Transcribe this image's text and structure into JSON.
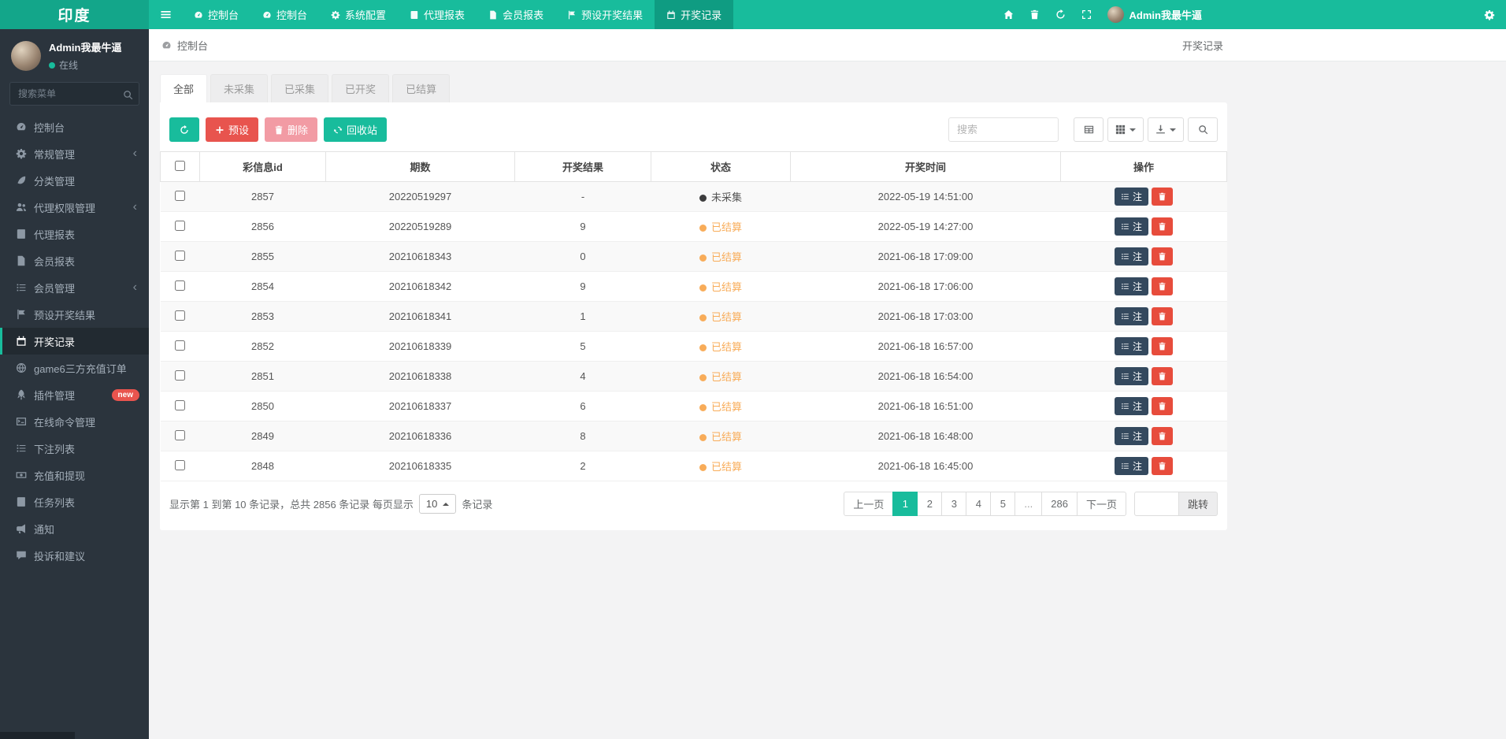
{
  "topbar": {
    "logo": "印度",
    "nav_items": [
      {
        "label": "控制台",
        "icon": "gauge",
        "active": false
      },
      {
        "label": "控制台",
        "icon": "gauge",
        "active": false
      },
      {
        "label": "系统配置",
        "icon": "gear",
        "active": false
      },
      {
        "label": "代理报表",
        "icon": "book",
        "active": false
      },
      {
        "label": "会员报表",
        "icon": "doc",
        "active": false
      },
      {
        "label": "预设开奖结果",
        "icon": "flag",
        "active": false
      },
      {
        "label": "开奖记录",
        "icon": "calendar",
        "active": true
      }
    ],
    "right_icons": [
      "home",
      "trash",
      "refresh",
      "expand"
    ],
    "user_name": "Admin我最牛逼"
  },
  "sidebar": {
    "user_name": "Admin我最牛逼",
    "status_label": "在线",
    "search_placeholder": "搜索菜单",
    "items": [
      {
        "label": "控制台",
        "icon": "gauge"
      },
      {
        "label": "常规管理",
        "icon": "gear",
        "chevron": true
      },
      {
        "label": "分类管理",
        "icon": "leaf"
      },
      {
        "label": "代理权限管理",
        "icon": "users",
        "chevron": true
      },
      {
        "label": "代理报表",
        "icon": "book"
      },
      {
        "label": "会员报表",
        "icon": "doc"
      },
      {
        "label": "会员管理",
        "icon": "list",
        "chevron": true
      },
      {
        "label": "预设开奖结果",
        "icon": "flag"
      },
      {
        "label": "开奖记录",
        "icon": "calendar",
        "active": true
      },
      {
        "label": "game6三方充值订单",
        "icon": "globe"
      },
      {
        "label": "插件管理",
        "icon": "rocket",
        "badge": "new"
      },
      {
        "label": "在线命令管理",
        "icon": "terminal"
      },
      {
        "label": "下注列表",
        "icon": "list"
      },
      {
        "label": "充值和提现",
        "icon": "money"
      },
      {
        "label": "任务列表",
        "icon": "book"
      },
      {
        "label": "通知",
        "icon": "bullhorn"
      },
      {
        "label": "投诉和建议",
        "icon": "comment"
      }
    ]
  },
  "breadcrumb": {
    "left": "控制台",
    "right": "开奖记录"
  },
  "tabs": [
    {
      "label": "全部",
      "active": true
    },
    {
      "label": "未采集",
      "active": false
    },
    {
      "label": "已采集",
      "active": false
    },
    {
      "label": "已开奖",
      "active": false
    },
    {
      "label": "已结算",
      "active": false
    }
  ],
  "toolbar": {
    "preset_label": "预设",
    "delete_label": "删除",
    "recycle_label": "回收站",
    "search_placeholder": "搜索"
  },
  "table": {
    "columns": [
      "彩信息id",
      "期数",
      "开奖结果",
      "状态",
      "开奖时间",
      "操作"
    ],
    "note_label": "注",
    "rows": [
      {
        "id": "2857",
        "period": "20220519297",
        "result": "-",
        "status": "未采集",
        "status_type": "uncollected",
        "time": "2022-05-19 14:51:00"
      },
      {
        "id": "2856",
        "period": "20220519289",
        "result": "9",
        "status": "已结算",
        "status_type": "settled",
        "time": "2022-05-19 14:27:00"
      },
      {
        "id": "2855",
        "period": "20210618343",
        "result": "0",
        "status": "已结算",
        "status_type": "settled",
        "time": "2021-06-18 17:09:00"
      },
      {
        "id": "2854",
        "period": "20210618342",
        "result": "9",
        "status": "已结算",
        "status_type": "settled",
        "time": "2021-06-18 17:06:00"
      },
      {
        "id": "2853",
        "period": "20210618341",
        "result": "1",
        "status": "已结算",
        "status_type": "settled",
        "time": "2021-06-18 17:03:00"
      },
      {
        "id": "2852",
        "period": "20210618339",
        "result": "5",
        "status": "已结算",
        "status_type": "settled",
        "time": "2021-06-18 16:57:00"
      },
      {
        "id": "2851",
        "period": "20210618338",
        "result": "4",
        "status": "已结算",
        "status_type": "settled",
        "time": "2021-06-18 16:54:00"
      },
      {
        "id": "2850",
        "period": "20210618337",
        "result": "6",
        "status": "已结算",
        "status_type": "settled",
        "time": "2021-06-18 16:51:00"
      },
      {
        "id": "2849",
        "period": "20210618336",
        "result": "8",
        "status": "已结算",
        "status_type": "settled",
        "time": "2021-06-18 16:48:00"
      },
      {
        "id": "2848",
        "period": "20210618335",
        "result": "2",
        "status": "已结算",
        "status_type": "settled",
        "time": "2021-06-18 16:45:00"
      }
    ]
  },
  "footer": {
    "summary_prefix": "显示第 1 到第 10 条记录，总共 2856 条记录 每页显示",
    "page_size": "10",
    "summary_suffix": "条记录",
    "pages": [
      {
        "label": "上一页",
        "type": "prev"
      },
      {
        "label": "1",
        "type": "page",
        "active": true
      },
      {
        "label": "2",
        "type": "page"
      },
      {
        "label": "3",
        "type": "page"
      },
      {
        "label": "4",
        "type": "page"
      },
      {
        "label": "5",
        "type": "page"
      },
      {
        "label": "...",
        "type": "ellipsis"
      },
      {
        "label": "286",
        "type": "page"
      },
      {
        "label": "下一页",
        "type": "next"
      }
    ],
    "jump_label": "跳转"
  },
  "colors": {
    "teal": "#18bc9c",
    "sidebar_bg": "#2b343d",
    "red": "#e8544e",
    "orange": "#f8ac59"
  }
}
